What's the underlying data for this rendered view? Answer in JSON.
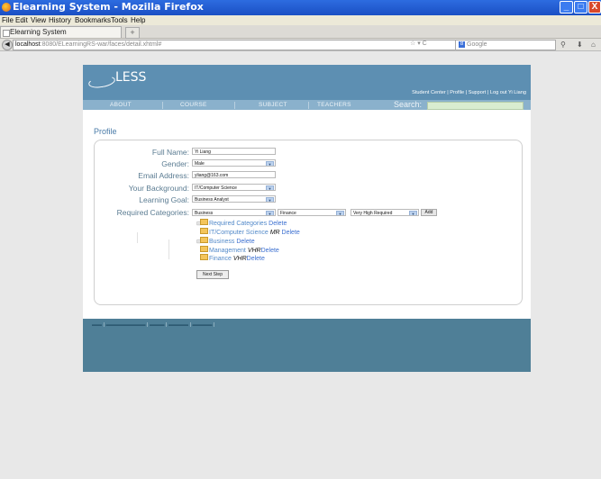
{
  "browser": {
    "window_title": "Elearning System - Mozilla Firefox",
    "menu": [
      "File",
      "Edit",
      "View",
      "History",
      "Bookmarks",
      "Tools",
      "Help"
    ],
    "tab_title": "Elearning System",
    "new_tab": "+",
    "url_host": "localhost",
    "url_path": ":8080/ELearningRS-war/faces/detail.xhtml#",
    "search_engine": "Google",
    "window_buttons": {
      "min": "_",
      "max": "□",
      "close": "X"
    }
  },
  "site": {
    "logo": "LESS",
    "top_links": "Student Center | Profile | Support | Log out Yi Liang",
    "nav": [
      "ABOUT",
      "COURSE",
      "SUBJECT",
      "TEACHERS"
    ],
    "search_label": "Search:",
    "accent_color": "#5d8fb2",
    "nav_color": "#8ab1cc"
  },
  "profile": {
    "title": "Profile",
    "fields": {
      "full_name": {
        "label": "Full Name:",
        "value": "Yi Liang"
      },
      "gender": {
        "label": "Gender:",
        "value": "Male"
      },
      "email": {
        "label": "Email Address:",
        "value": "yliang@163.com"
      },
      "background": {
        "label": "Your Background:",
        "value": "IT/Computer Science"
      },
      "goal": {
        "label": "Learning Goal:",
        "value": "Business Analyst"
      },
      "required": {
        "label": "Required Categories:",
        "category": "Business",
        "subcategory": "Finance",
        "level": "Very High Required",
        "add_label": "Add"
      }
    },
    "tree": [
      {
        "name": "Required Categories",
        "level": "",
        "delete": "Delete"
      },
      {
        "name": "IT/Computer Science",
        "level": "MR",
        "delete": "Delete"
      },
      {
        "name": "Business",
        "level": "",
        "delete": "Delete"
      },
      {
        "name": "Management",
        "level": "VHR",
        "delete": "Delete"
      },
      {
        "name": "Finance",
        "level": "VHR",
        "delete": "Delete"
      }
    ],
    "next_label": "Next Step"
  }
}
